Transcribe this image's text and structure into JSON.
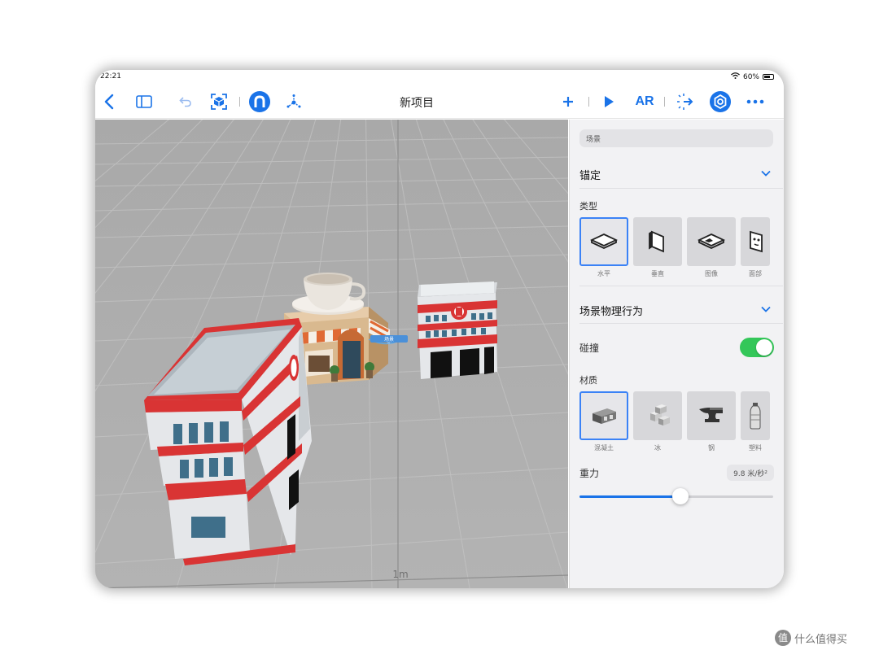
{
  "status_bar": {
    "time": "22:21",
    "battery": "60%"
  },
  "toolbar": {
    "title": "新项目",
    "ar_label": "AR"
  },
  "viewport": {
    "scale_label": "1m",
    "anchor_tag": "场景"
  },
  "inspector": {
    "search_text": "场景",
    "anchoring": {
      "title": "锚定",
      "type_label": "类型",
      "types": [
        {
          "label": "水平",
          "icon": "horizontal-plane-icon"
        },
        {
          "label": "垂直",
          "icon": "vertical-plane-icon"
        },
        {
          "label": "图像",
          "icon": "image-anchor-icon"
        },
        {
          "label": "面部",
          "icon": "face-anchor-icon"
        }
      ]
    },
    "physics": {
      "title": "场景物理行为",
      "collision_label": "碰撞",
      "collision_on": true,
      "material_label": "材质",
      "materials": [
        {
          "label": "混凝土",
          "icon": "concrete-icon"
        },
        {
          "label": "冰",
          "icon": "ice-icon"
        },
        {
          "label": "钢",
          "icon": "steel-icon"
        },
        {
          "label": "塑料",
          "icon": "plastic-icon"
        }
      ],
      "gravity_label": "重力",
      "gravity_value": "9.8 米/秒²",
      "gravity_slider_fraction": 0.52
    }
  },
  "watermark": {
    "badge": "值",
    "text": "什么值得买"
  },
  "colors": {
    "accent": "#1a73e8",
    "toggle_on": "#34c759",
    "grid_bg": "#aeaeae"
  }
}
